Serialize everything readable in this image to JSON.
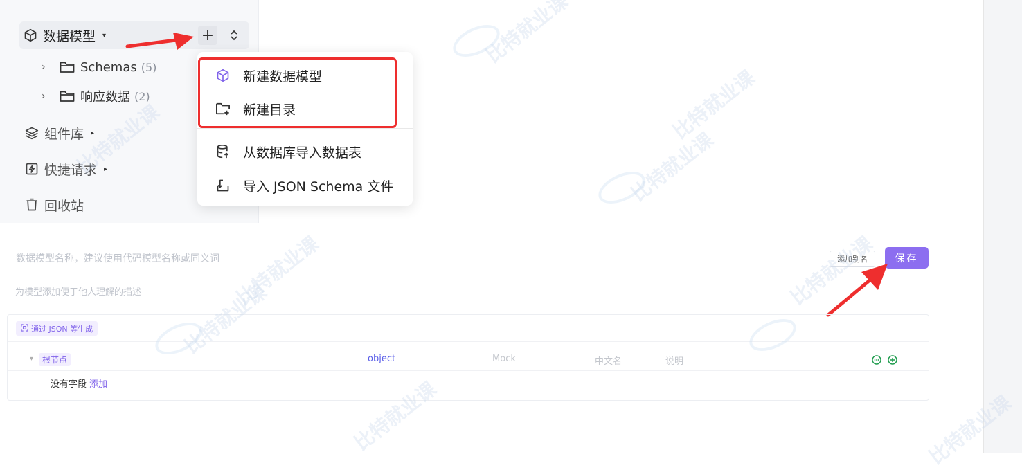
{
  "sidebar": {
    "root": {
      "label": "数据模型",
      "caret": "▾"
    },
    "children": [
      {
        "label": "Schemas",
        "count": "(5)"
      },
      {
        "label": "响应数据",
        "count": "(2)"
      }
    ],
    "sections": [
      {
        "label": "组件库",
        "caret": "▸"
      },
      {
        "label": "快捷请求",
        "caret": "▸"
      },
      {
        "label": "回收站"
      }
    ],
    "add_button": "+",
    "sort_button": "⌃⌄"
  },
  "dropdown": {
    "items": [
      {
        "label": "新建数据模型",
        "icon": "cube-icon"
      },
      {
        "label": "新建目录",
        "icon": "folder-plus-icon"
      },
      {
        "label": "从数据库导入数据表",
        "icon": "database-import-icon"
      },
      {
        "label": "导入 JSON Schema 文件",
        "icon": "import-icon"
      }
    ]
  },
  "form": {
    "name_placeholder": "数据模型名称，建议使用代码模型名称或同义词",
    "alias_button": "添加别名",
    "save_button": "保存",
    "description_placeholder": "为模型添加便于他人理解的描述"
  },
  "schema": {
    "generate_button": "通过 JSON 等生成",
    "root_label": "根节点",
    "root_type": "object",
    "mock_placeholder": "Mock",
    "cn_name_placeholder": "中文名",
    "note_placeholder": "说明",
    "empty_text": "没有字段",
    "add_link": "添加"
  },
  "watermark": {
    "text": "比特就业课"
  },
  "colors": {
    "accent": "#8c6ef0",
    "highlight_box": "#ee2e2e",
    "arrow": "#ee2e2e",
    "type_blue": "#5a5ee8",
    "action_green": "#1a9a4a"
  }
}
